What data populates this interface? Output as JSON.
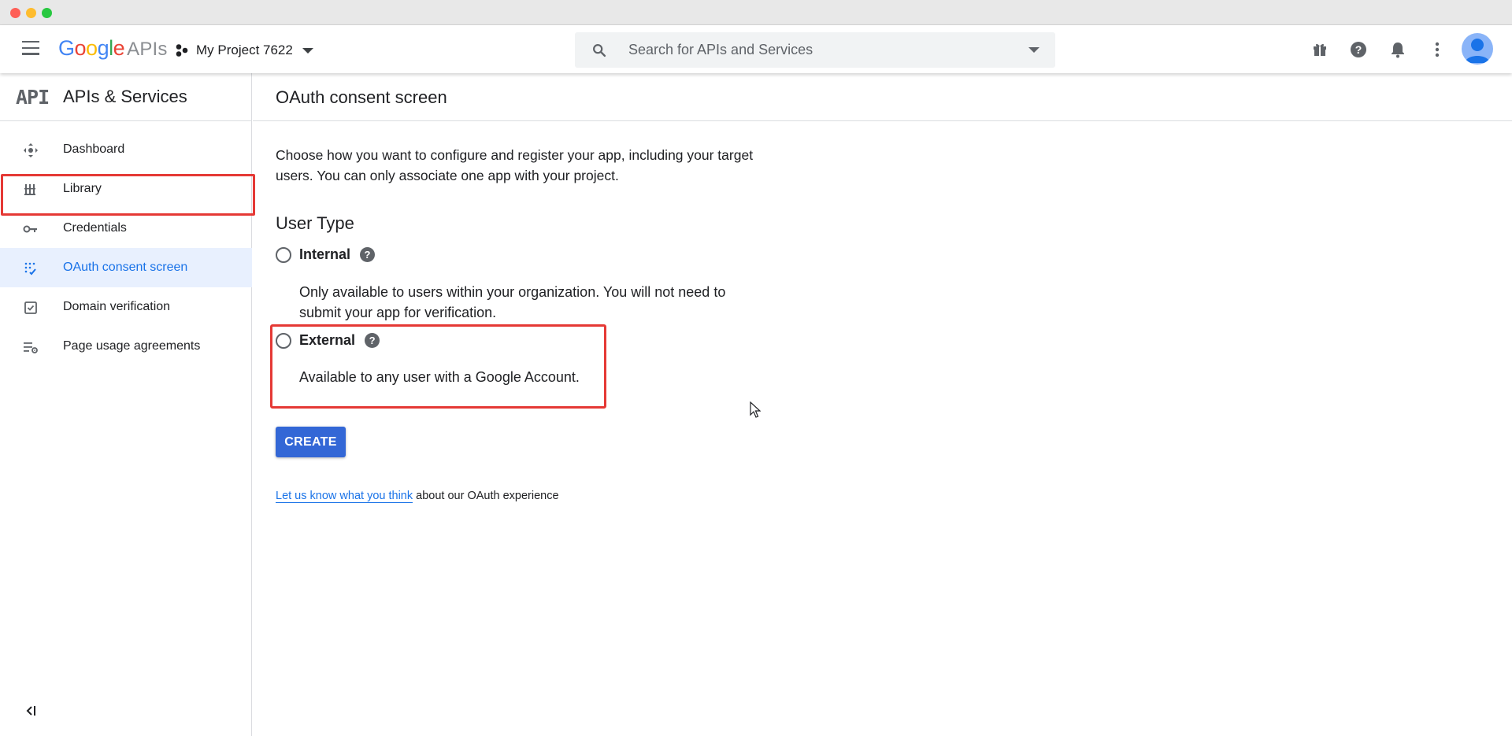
{
  "header": {
    "logo_google": "Google",
    "logo_apis": "APIs",
    "project_name": "My Project 7622",
    "search_placeholder": "Search for APIs and Services",
    "icons": [
      "menu-icon",
      "project-icon",
      "search-icon",
      "gift-icon",
      "help-icon",
      "notifications-icon",
      "more-vert-icon",
      "avatar"
    ]
  },
  "sidebar": {
    "logo": "API",
    "title": "APIs & Services",
    "items": [
      {
        "label": "Dashboard",
        "icon": "dashboard-icon",
        "active": false
      },
      {
        "label": "Library",
        "icon": "library-icon",
        "active": false
      },
      {
        "label": "Credentials",
        "icon": "key-icon",
        "active": false
      },
      {
        "label": "OAuth consent screen",
        "icon": "oauth-icon",
        "active": true
      },
      {
        "label": "Domain verification",
        "icon": "domain-verification-icon",
        "active": false
      },
      {
        "label": "Page usage agreements",
        "icon": "page-usage-icon",
        "active": false
      }
    ]
  },
  "main": {
    "title": "OAuth consent screen",
    "intro": "Choose how you want to configure and register your app, including your target users. You can only associate one app with your project.",
    "user_type_heading": "User Type",
    "options": [
      {
        "label": "Internal",
        "description": "Only available to users within your organization. You will not need to submit your app for verification.",
        "selected": false
      },
      {
        "label": "External",
        "description": "Available to any user with a Google Account.",
        "selected": false
      }
    ],
    "help_glyph": "?",
    "create_label": "CREATE",
    "feedback_link": "Let us know what you think",
    "feedback_rest": " about our OAuth experience"
  },
  "colors": {
    "accent": "#1a73e8",
    "button": "#3367d6",
    "highlight": "#e53935",
    "active_bg": "#e8f0fe"
  }
}
